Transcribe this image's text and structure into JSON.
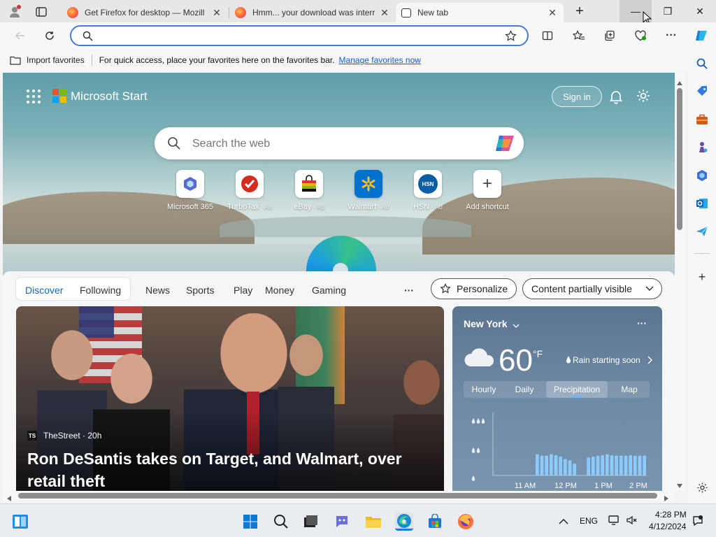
{
  "tabs": [
    {
      "title": "Get Firefox for desktop — Mozill",
      "close": "✕"
    },
    {
      "title": "Hmm... your download was interr",
      "close": "✕"
    },
    {
      "title": "New tab",
      "close": "✕"
    }
  ],
  "titlebar": {
    "new_tab": "+",
    "minimize": "—",
    "restore": "❐",
    "close": "✕"
  },
  "address": {
    "placeholder": "",
    "value": ""
  },
  "favorites_bar": {
    "import_label": "Import favorites",
    "message": "For quick access, place your favorites here on the favorites bar.",
    "manage_link": "Manage favorites now"
  },
  "start": {
    "brand": "Microsoft Start",
    "sign_in": "Sign in",
    "search_placeholder": "Search the web",
    "shortcuts": [
      {
        "label": "Microsoft 365",
        "ad": ""
      },
      {
        "label": "TurboTax",
        "ad": " · Ad"
      },
      {
        "label": "eBay",
        "ad": " · Ad"
      },
      {
        "label": "Walmart",
        "ad": " · Ad"
      },
      {
        "label": "HSN",
        "ad": " · Ad"
      },
      {
        "label": "Add shortcut",
        "ad": ""
      }
    ],
    "hsn_text": "HSN"
  },
  "feed": {
    "tabs": [
      "Discover",
      "Following",
      "News",
      "Sports",
      "Play",
      "Money",
      "Gaming"
    ],
    "more": "···",
    "personalize": "Personalize",
    "content_visibility": "Content partially visible"
  },
  "article": {
    "source_badge": "TS",
    "source": "TheStreet · 20h",
    "headline_line1": "Ron DeSantis takes on Target, and Walmart, over",
    "headline_line2": "retail theft"
  },
  "weather": {
    "location": "New York",
    "temperature": "60",
    "unit": "°F",
    "alert": "Rain starting soon",
    "more": "···",
    "tabs": [
      "Hourly",
      "Daily",
      "Precipitation",
      "Map"
    ],
    "selected_tab": "Precipitation",
    "time_labels": [
      "11 AM",
      "12 PM",
      "1 PM",
      "2 PM"
    ]
  },
  "chart_data": {
    "type": "bar",
    "title": "",
    "xlabel": "",
    "ylabel": "",
    "categories": [
      "11 AM",
      "12 PM",
      "1 PM",
      "2 PM"
    ],
    "series": [
      {
        "values": [
          0,
          0,
          0,
          0,
          0,
          0,
          0,
          0,
          0,
          0.45,
          0.42,
          0.42,
          0.45,
          0.43,
          0.4,
          0.35,
          0.32,
          0.25,
          0,
          0,
          0.38,
          0.4,
          0.42,
          0.43,
          0.45,
          0.43,
          0.42,
          0.42,
          0.42,
          0.43,
          0.42,
          0.42,
          0.42
        ]
      }
    ],
    "levels": [
      "heavy",
      "moderate",
      "light"
    ]
  },
  "taskbar": {
    "language": "ENG",
    "time": "4:28 PM",
    "date": "4/12/2024"
  },
  "colors": {
    "accent": "#0f6cbd",
    "link": "#0f5fc7"
  }
}
